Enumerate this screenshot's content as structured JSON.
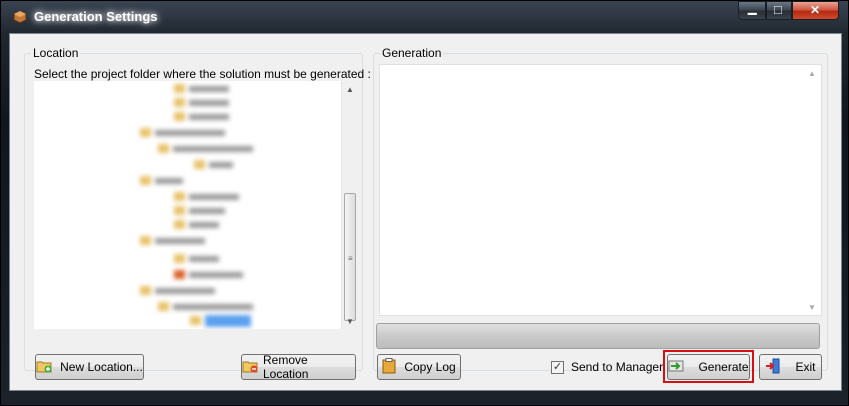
{
  "window": {
    "title": "Generation Settings",
    "min_glyph": "▁",
    "max_glyph": "□",
    "close_glyph": "✕"
  },
  "location": {
    "group_label": "Location",
    "hint": "Select the project folder where the solution must be generated :",
    "new_location_label": "New Location...",
    "remove_location_label": "Remove Location"
  },
  "generation": {
    "group_label": "Generation",
    "copy_log_label": "Copy Log",
    "send_to_manager_label": "Send to Manager",
    "send_to_manager_checked": true,
    "generate_label": "Generate",
    "exit_label": "Exit"
  },
  "colors": {
    "accent_highlight": "#d41010",
    "folder": "#e8c26a",
    "selection": "#5aa0ef"
  }
}
